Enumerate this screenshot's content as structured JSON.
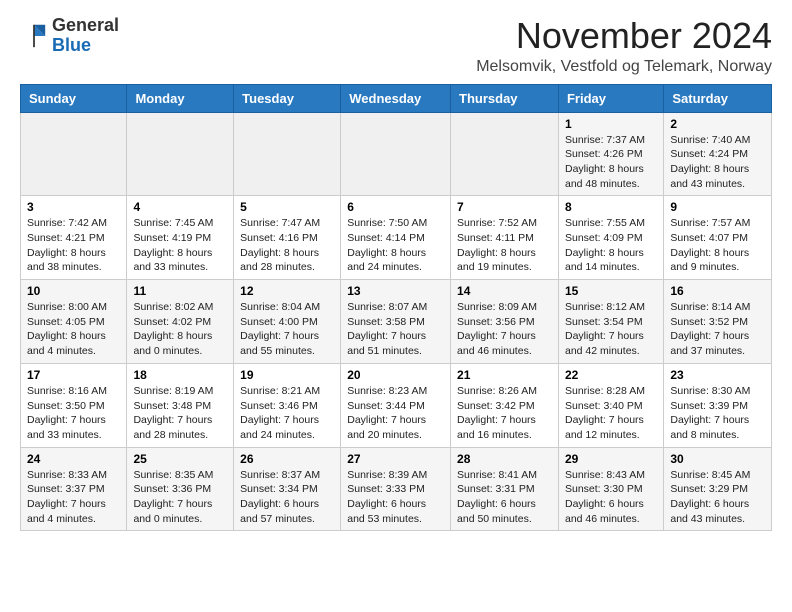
{
  "logo": {
    "general": "General",
    "blue": "Blue"
  },
  "header": {
    "title": "November 2024",
    "subtitle": "Melsomvik, Vestfold og Telemark, Norway"
  },
  "calendar": {
    "days": [
      "Sunday",
      "Monday",
      "Tuesday",
      "Wednesday",
      "Thursday",
      "Friday",
      "Saturday"
    ],
    "weeks": [
      [
        {
          "day": "",
          "info": ""
        },
        {
          "day": "",
          "info": ""
        },
        {
          "day": "",
          "info": ""
        },
        {
          "day": "",
          "info": ""
        },
        {
          "day": "",
          "info": ""
        },
        {
          "day": "1",
          "info": "Sunrise: 7:37 AM\nSunset: 4:26 PM\nDaylight: 8 hours\nand 48 minutes."
        },
        {
          "day": "2",
          "info": "Sunrise: 7:40 AM\nSunset: 4:24 PM\nDaylight: 8 hours\nand 43 minutes."
        }
      ],
      [
        {
          "day": "3",
          "info": "Sunrise: 7:42 AM\nSunset: 4:21 PM\nDaylight: 8 hours\nand 38 minutes."
        },
        {
          "day": "4",
          "info": "Sunrise: 7:45 AM\nSunset: 4:19 PM\nDaylight: 8 hours\nand 33 minutes."
        },
        {
          "day": "5",
          "info": "Sunrise: 7:47 AM\nSunset: 4:16 PM\nDaylight: 8 hours\nand 28 minutes."
        },
        {
          "day": "6",
          "info": "Sunrise: 7:50 AM\nSunset: 4:14 PM\nDaylight: 8 hours\nand 24 minutes."
        },
        {
          "day": "7",
          "info": "Sunrise: 7:52 AM\nSunset: 4:11 PM\nDaylight: 8 hours\nand 19 minutes."
        },
        {
          "day": "8",
          "info": "Sunrise: 7:55 AM\nSunset: 4:09 PM\nDaylight: 8 hours\nand 14 minutes."
        },
        {
          "day": "9",
          "info": "Sunrise: 7:57 AM\nSunset: 4:07 PM\nDaylight: 8 hours\nand 9 minutes."
        }
      ],
      [
        {
          "day": "10",
          "info": "Sunrise: 8:00 AM\nSunset: 4:05 PM\nDaylight: 8 hours\nand 4 minutes."
        },
        {
          "day": "11",
          "info": "Sunrise: 8:02 AM\nSunset: 4:02 PM\nDaylight: 8 hours\nand 0 minutes."
        },
        {
          "day": "12",
          "info": "Sunrise: 8:04 AM\nSunset: 4:00 PM\nDaylight: 7 hours\nand 55 minutes."
        },
        {
          "day": "13",
          "info": "Sunrise: 8:07 AM\nSunset: 3:58 PM\nDaylight: 7 hours\nand 51 minutes."
        },
        {
          "day": "14",
          "info": "Sunrise: 8:09 AM\nSunset: 3:56 PM\nDaylight: 7 hours\nand 46 minutes."
        },
        {
          "day": "15",
          "info": "Sunrise: 8:12 AM\nSunset: 3:54 PM\nDaylight: 7 hours\nand 42 minutes."
        },
        {
          "day": "16",
          "info": "Sunrise: 8:14 AM\nSunset: 3:52 PM\nDaylight: 7 hours\nand 37 minutes."
        }
      ],
      [
        {
          "day": "17",
          "info": "Sunrise: 8:16 AM\nSunset: 3:50 PM\nDaylight: 7 hours\nand 33 minutes."
        },
        {
          "day": "18",
          "info": "Sunrise: 8:19 AM\nSunset: 3:48 PM\nDaylight: 7 hours\nand 28 minutes."
        },
        {
          "day": "19",
          "info": "Sunrise: 8:21 AM\nSunset: 3:46 PM\nDaylight: 7 hours\nand 24 minutes."
        },
        {
          "day": "20",
          "info": "Sunrise: 8:23 AM\nSunset: 3:44 PM\nDaylight: 7 hours\nand 20 minutes."
        },
        {
          "day": "21",
          "info": "Sunrise: 8:26 AM\nSunset: 3:42 PM\nDaylight: 7 hours\nand 16 minutes."
        },
        {
          "day": "22",
          "info": "Sunrise: 8:28 AM\nSunset: 3:40 PM\nDaylight: 7 hours\nand 12 minutes."
        },
        {
          "day": "23",
          "info": "Sunrise: 8:30 AM\nSunset: 3:39 PM\nDaylight: 7 hours\nand 8 minutes."
        }
      ],
      [
        {
          "day": "24",
          "info": "Sunrise: 8:33 AM\nSunset: 3:37 PM\nDaylight: 7 hours\nand 4 minutes."
        },
        {
          "day": "25",
          "info": "Sunrise: 8:35 AM\nSunset: 3:36 PM\nDaylight: 7 hours\nand 0 minutes."
        },
        {
          "day": "26",
          "info": "Sunrise: 8:37 AM\nSunset: 3:34 PM\nDaylight: 6 hours\nand 57 minutes."
        },
        {
          "day": "27",
          "info": "Sunrise: 8:39 AM\nSunset: 3:33 PM\nDaylight: 6 hours\nand 53 minutes."
        },
        {
          "day": "28",
          "info": "Sunrise: 8:41 AM\nSunset: 3:31 PM\nDaylight: 6 hours\nand 50 minutes."
        },
        {
          "day": "29",
          "info": "Sunrise: 8:43 AM\nSunset: 3:30 PM\nDaylight: 6 hours\nand 46 minutes."
        },
        {
          "day": "30",
          "info": "Sunrise: 8:45 AM\nSunset: 3:29 PM\nDaylight: 6 hours\nand 43 minutes."
        }
      ]
    ]
  }
}
